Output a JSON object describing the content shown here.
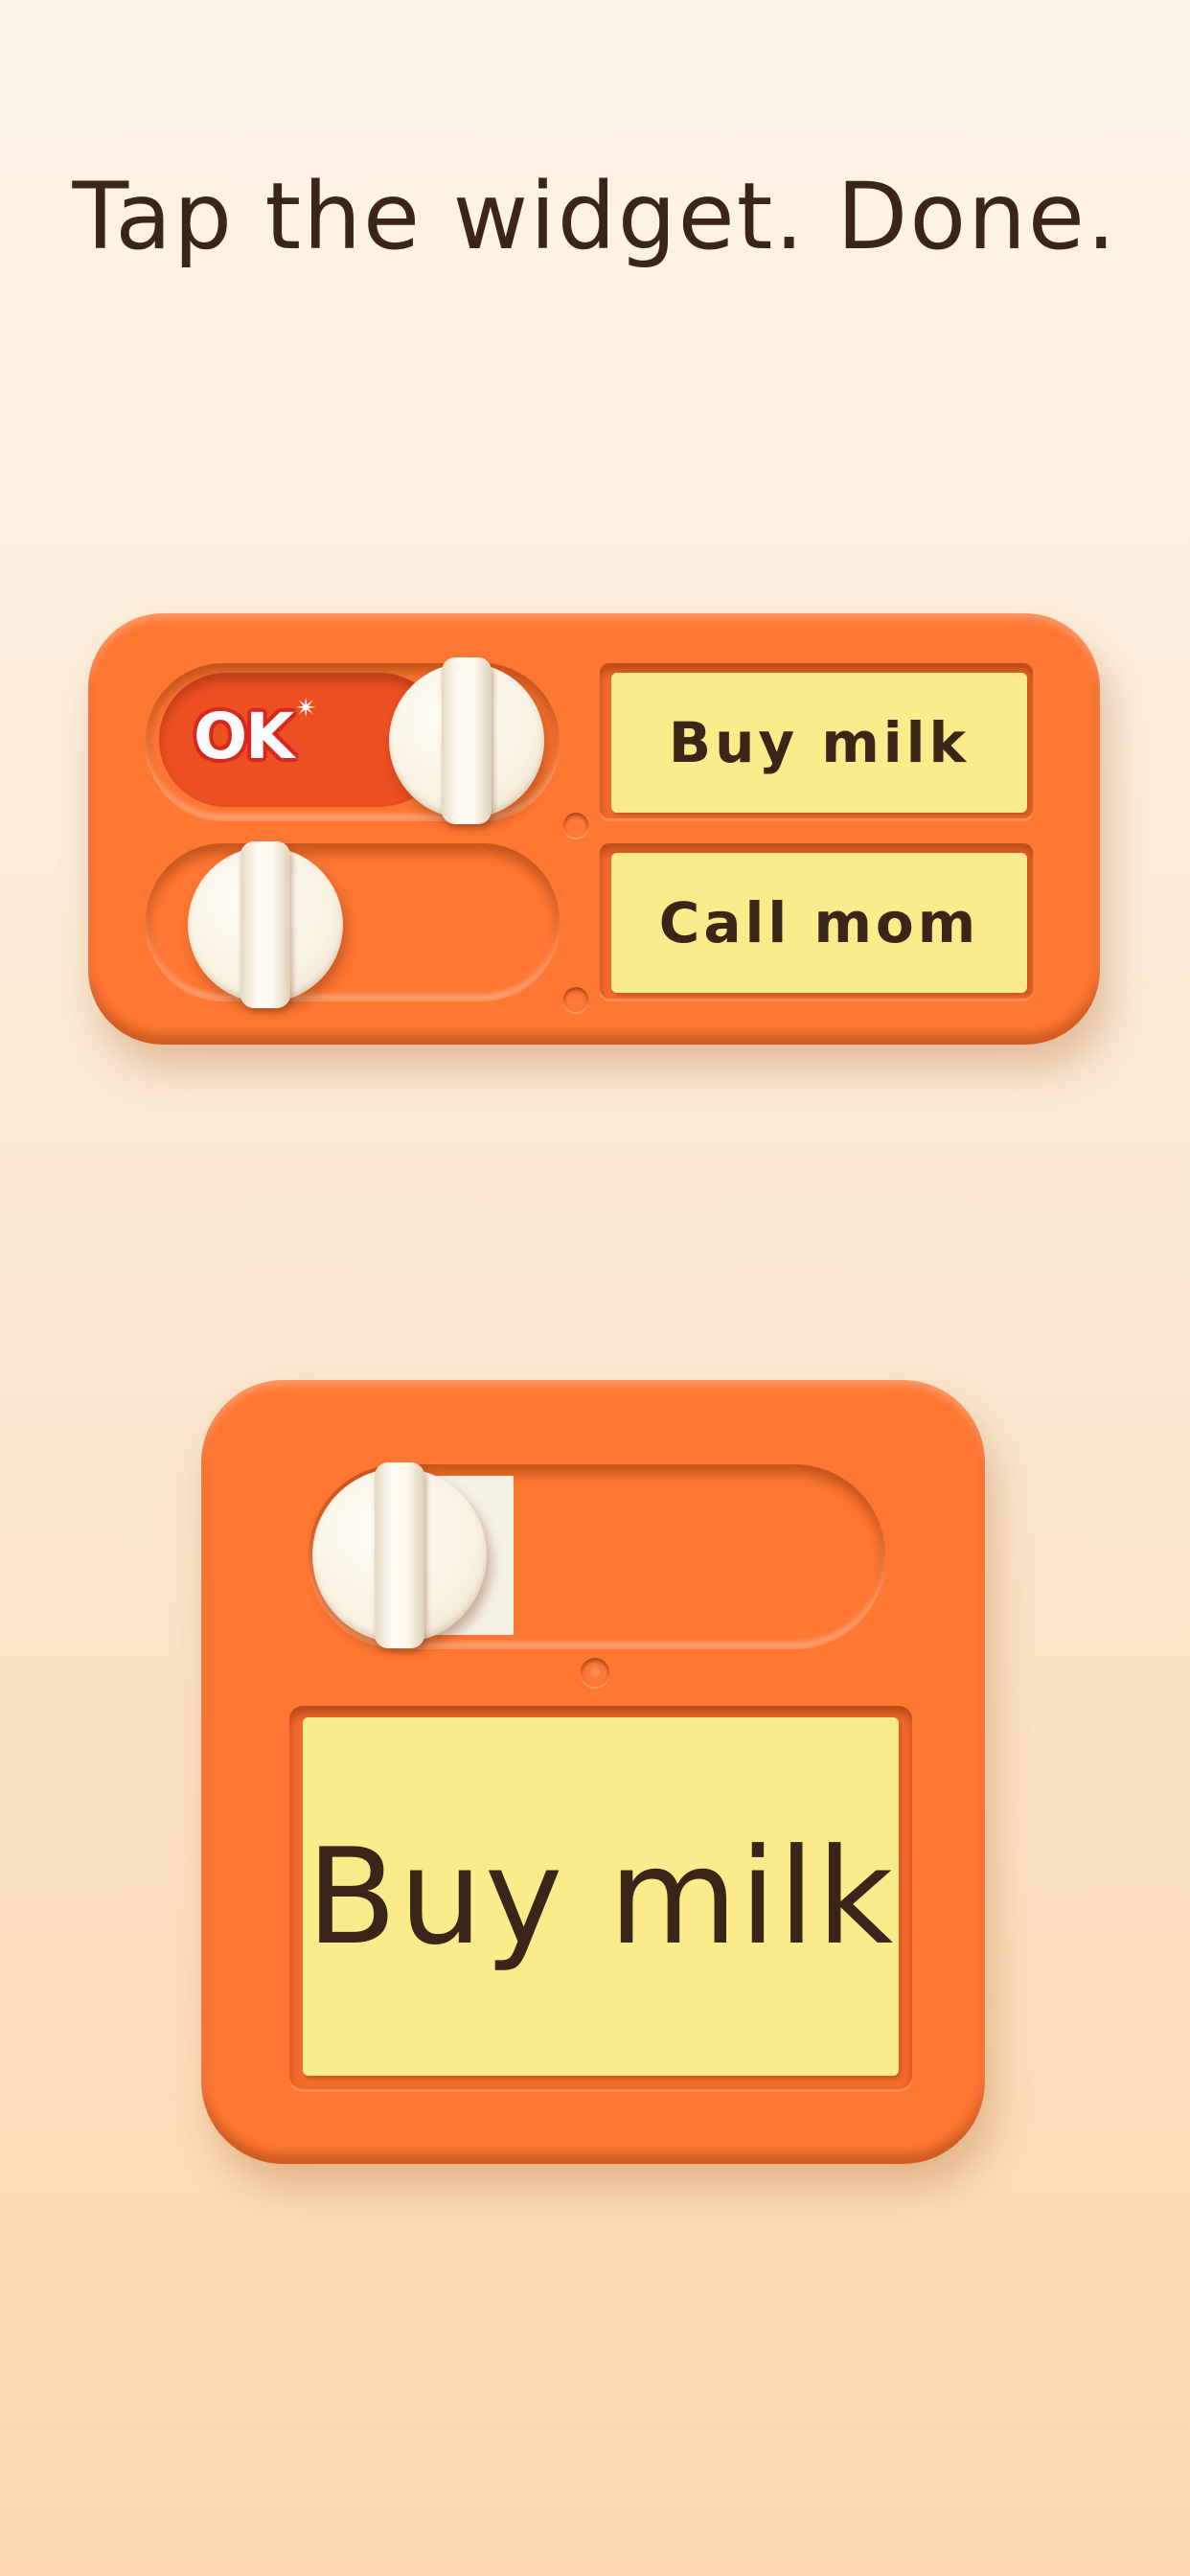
{
  "headline": "Tap the widget. Done.",
  "wide_widget": {
    "rows": [
      {
        "switch_on": true,
        "badge": "OK",
        "note": "Buy milk"
      },
      {
        "switch_on": false,
        "note": "Call mom"
      }
    ]
  },
  "square_widget": {
    "switch_on": false,
    "note": "Buy milk"
  },
  "colors": {
    "widget_orange": "#fe7733",
    "switch_on_red": "#eb4f22",
    "note_yellow": "#fbeb8b",
    "knob_cream": "#f9f1e1",
    "text_dark": "#3a2518",
    "badge_red": "#d8271e"
  }
}
